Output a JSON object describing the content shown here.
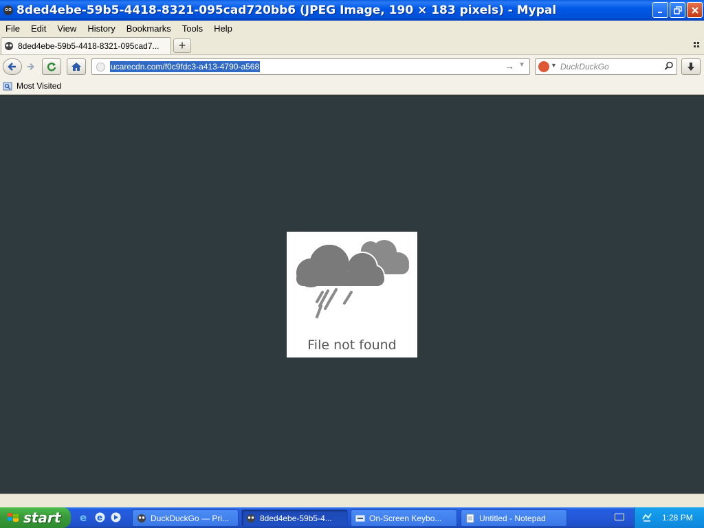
{
  "window": {
    "title": "8ded4ebe-59b5-4418-8321-095cad720bb6 (JPEG Image, 190 × 183 pixels) - Mypal"
  },
  "menu": [
    "File",
    "Edit",
    "View",
    "History",
    "Bookmarks",
    "Tools",
    "Help"
  ],
  "menu_accel": [
    "F",
    "E",
    "V",
    "H",
    "B",
    "T",
    "H"
  ],
  "tab": {
    "label": "8ded4ebe-59b5-4418-8321-095cad7..."
  },
  "newtab": {
    "label": "+"
  },
  "urlbar": {
    "value": "ucarecdn.com/f0c9fdc3-a413-4790-a568"
  },
  "search": {
    "placeholder": "DuckDuckGo"
  },
  "bookmarks": {
    "most_visited": "Most Visited"
  },
  "content": {
    "error_text": "File not found"
  },
  "taskbar": {
    "start": "start",
    "tasks": [
      {
        "label": "DuckDuckGo — Pri..."
      },
      {
        "label": "8ded4ebe-59b5-4..."
      },
      {
        "label": "On-Screen Keybo..."
      },
      {
        "label": "Untitled - Notepad"
      }
    ],
    "clock": "1:28 PM"
  },
  "colors": {
    "content_bg": "#2f3a3e",
    "titlebar": "#0058e6",
    "taskbar": "#245ee0",
    "start": "#3b9d3b",
    "cloud": "#7a7a7a"
  }
}
